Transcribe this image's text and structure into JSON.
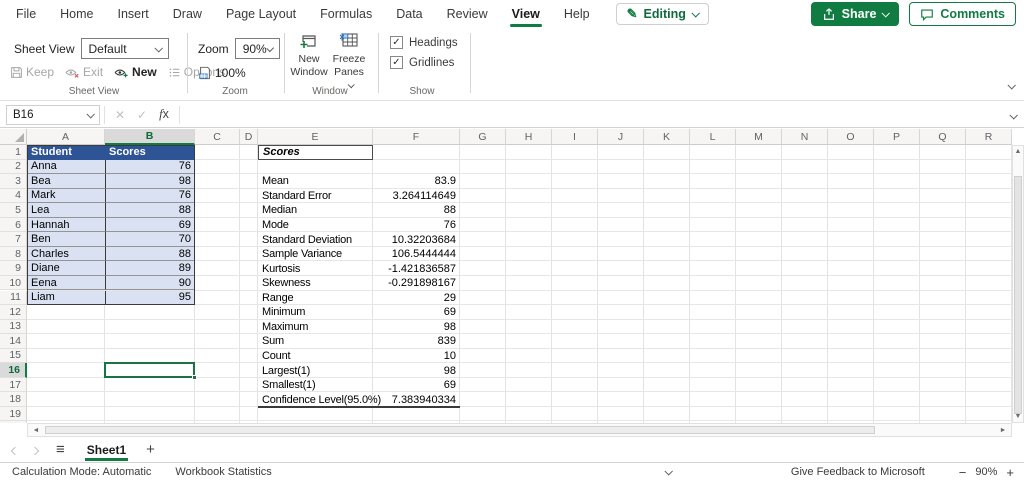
{
  "colors": {
    "accent_green": "#107C41",
    "selection_green": "#1E7145",
    "table_header_bg": "#2F5496",
    "table_row_bg": "#D9E1F2",
    "tab_underline": "#107C41"
  },
  "app": {
    "tabs": [
      "File",
      "Home",
      "Insert",
      "Draw",
      "Page Layout",
      "Formulas",
      "Data",
      "Review",
      "View",
      "Help"
    ],
    "active_tab": "View",
    "editing_label": "Editing",
    "share_label": "Share",
    "comments_label": "Comments"
  },
  "ribbon": {
    "sheet_view": {
      "field_label": "Sheet View",
      "dropdown_value": "Default",
      "buttons": [
        {
          "label": "Keep",
          "disabled": true
        },
        {
          "label": "Exit",
          "disabled": true
        },
        {
          "label": "New",
          "disabled": false
        },
        {
          "label": "Options",
          "disabled": true
        }
      ],
      "group_label": "Sheet View"
    },
    "zoom": {
      "field_label": "Zoom",
      "dropdown_value": "90%",
      "button_label": "100%",
      "group_label": "Zoom"
    },
    "window": {
      "buttons": [
        {
          "label": "New Window",
          "has_chevron": false
        },
        {
          "label": "Freeze Panes",
          "has_chevron": true
        }
      ],
      "group_label": "Window"
    },
    "show": {
      "items": [
        {
          "label": "Headings",
          "checked": true
        },
        {
          "label": "Gridlines",
          "checked": true
        }
      ],
      "group_label": "Show"
    }
  },
  "formula_bar": {
    "name_box_value": "B16",
    "cancel_glyph": "✕",
    "enter_glyph": "✓",
    "fx_label": "x",
    "formula_value": ""
  },
  "grid": {
    "columns": [
      {
        "letter": "A",
        "width": 78
      },
      {
        "letter": "B",
        "width": 90
      },
      {
        "letter": "C",
        "width": 45
      },
      {
        "letter": "D",
        "width": 18
      },
      {
        "letter": "E",
        "width": 115
      },
      {
        "letter": "F",
        "width": 87
      },
      {
        "letter": "G",
        "width": 46
      },
      {
        "letter": "H",
        "width": 46
      },
      {
        "letter": "I",
        "width": 46
      },
      {
        "letter": "J",
        "width": 46
      },
      {
        "letter": "K",
        "width": 46
      },
      {
        "letter": "L",
        "width": 46
      },
      {
        "letter": "M",
        "width": 46
      },
      {
        "letter": "N",
        "width": 46
      },
      {
        "letter": "O",
        "width": 46
      },
      {
        "letter": "P",
        "width": 46
      },
      {
        "letter": "Q",
        "width": 46
      },
      {
        "letter": "R",
        "width": 46
      }
    ],
    "visible_rows": 20,
    "selected_cell": {
      "column": "B",
      "row": 16,
      "ref": "B16"
    },
    "table": {
      "header": [
        "Student",
        "Scores"
      ],
      "rows": [
        [
          "Anna",
          "76"
        ],
        [
          "Bea",
          "98"
        ],
        [
          "Mark",
          "76"
        ],
        [
          "Lea",
          "88"
        ],
        [
          "Hannah",
          "69"
        ],
        [
          "Ben",
          "70"
        ],
        [
          "Charles",
          "88"
        ],
        [
          "Diane",
          "89"
        ],
        [
          "Eena",
          "90"
        ],
        [
          "Liam",
          "95"
        ]
      ]
    },
    "stats": {
      "title": "Scores",
      "items": [
        {
          "row": 3,
          "label": "Mean",
          "value": "83.9"
        },
        {
          "row": 4,
          "label": "Standard Error",
          "value": "3.264114649"
        },
        {
          "row": 5,
          "label": "Median",
          "value": "88"
        },
        {
          "row": 6,
          "label": "Mode",
          "value": "76"
        },
        {
          "row": 7,
          "label": "Standard Deviation",
          "value": "10.32203684"
        },
        {
          "row": 8,
          "label": "Sample Variance",
          "value": "106.5444444"
        },
        {
          "row": 9,
          "label": "Kurtosis",
          "value": "-1.421836587"
        },
        {
          "row": 10,
          "label": "Skewness",
          "value": "-0.291898167"
        },
        {
          "row": 11,
          "label": "Range",
          "value": "29"
        },
        {
          "row": 12,
          "label": "Minimum",
          "value": "69"
        },
        {
          "row": 13,
          "label": "Maximum",
          "value": "98"
        },
        {
          "row": 14,
          "label": "Sum",
          "value": "839"
        },
        {
          "row": 15,
          "label": "Count",
          "value": "10"
        },
        {
          "row": 16,
          "label": "Largest(1)",
          "value": "98"
        },
        {
          "row": 17,
          "label": "Smallest(1)",
          "value": "69"
        },
        {
          "row": 18,
          "label": "Confidence Level(95.0%)",
          "value": "7.383940334"
        }
      ]
    }
  },
  "sheet_bar": {
    "active_sheet": "Sheet1",
    "add_glyph": "+"
  },
  "status_bar": {
    "calc_mode": "Calculation Mode: Automatic",
    "workbook_stats": "Workbook Statistics",
    "feedback": "Give Feedback to Microsoft",
    "zoom_out_glyph": "−",
    "zoom_level": "90%",
    "zoom_in_glyph": "+"
  }
}
